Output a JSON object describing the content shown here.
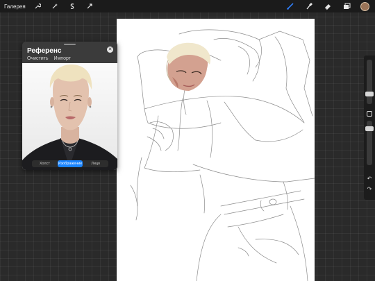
{
  "topbar": {
    "gallery_label": "Галерея",
    "left_tools": [
      "wrench-icon",
      "magic-wand-icon",
      "selection-icon",
      "transform-arrow-icon"
    ],
    "right_tools": [
      "brush-icon",
      "smudge-icon",
      "eraser-icon",
      "layers-icon"
    ],
    "active_color": "#9a7458",
    "accent": "#2f7cf6"
  },
  "reference": {
    "title": "Референс",
    "actions": [
      "Очистить",
      "Импорт"
    ],
    "segments": [
      "Холст",
      "Изображение",
      "Лицо"
    ],
    "active_segment": 1
  },
  "sidebar": {
    "brush_size_level": 0.25,
    "opacity_level": 0.85
  }
}
